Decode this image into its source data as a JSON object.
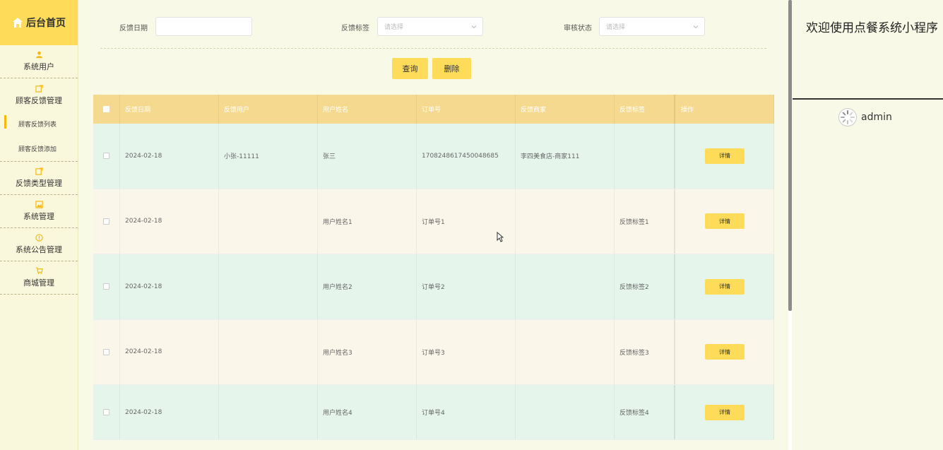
{
  "sidebar": {
    "logo": "后台首页",
    "items": [
      {
        "label": "系统用户",
        "icon": "user-icon"
      },
      {
        "label": "顾客反馈管理",
        "icon": "edit-icon"
      },
      {
        "label": "反馈类型管理",
        "icon": "edit-icon"
      },
      {
        "label": "系统管理",
        "icon": "image-icon"
      },
      {
        "label": "系统公告管理",
        "icon": "info-icon"
      },
      {
        "label": "商城管理",
        "icon": "cart-icon"
      }
    ],
    "submenu": [
      "顾客反馈列表",
      "顾客反馈添加"
    ]
  },
  "search": {
    "date_label": "反馈日期",
    "tag_label": "反馈标签",
    "tag_placeholder": "请选择",
    "status_label": "审核状态",
    "status_placeholder": "请选择",
    "query_button": "查询",
    "delete_button": "删除"
  },
  "table": {
    "headers": [
      "反馈日期",
      "反馈用户",
      "用户姓名",
      "订单号",
      "反馈商家",
      "反馈标签",
      "操作"
    ],
    "rows": [
      {
        "date": "2024-02-18",
        "user": "小张-11111",
        "name": "张三",
        "order": "1708248617450048685",
        "merchant": "李四美食店-商家111",
        "tag": ""
      },
      {
        "date": "2024-02-18",
        "user": "",
        "name": "用户姓名1",
        "order": "订单号1",
        "merchant": "",
        "tag": "反馈标签1"
      },
      {
        "date": "2024-02-18",
        "user": "",
        "name": "用户姓名2",
        "order": "订单号2",
        "merchant": "",
        "tag": "反馈标签2"
      },
      {
        "date": "2024-02-18",
        "user": "",
        "name": "用户姓名3",
        "order": "订单号3",
        "merchant": "",
        "tag": "反馈标签3"
      },
      {
        "date": "2024-02-18",
        "user": "",
        "name": "用户姓名4",
        "order": "订单号4",
        "merchant": "",
        "tag": "反馈标签4"
      }
    ],
    "detail_label": "详情"
  },
  "right": {
    "welcome": "欢迎使用点餐系统小程序",
    "username": "admin"
  },
  "colors": {
    "accent": "#fedc5a",
    "header_bg": "#f5d98f",
    "row_odd": "#e5f5ec",
    "row_even": "#faf6ea"
  }
}
